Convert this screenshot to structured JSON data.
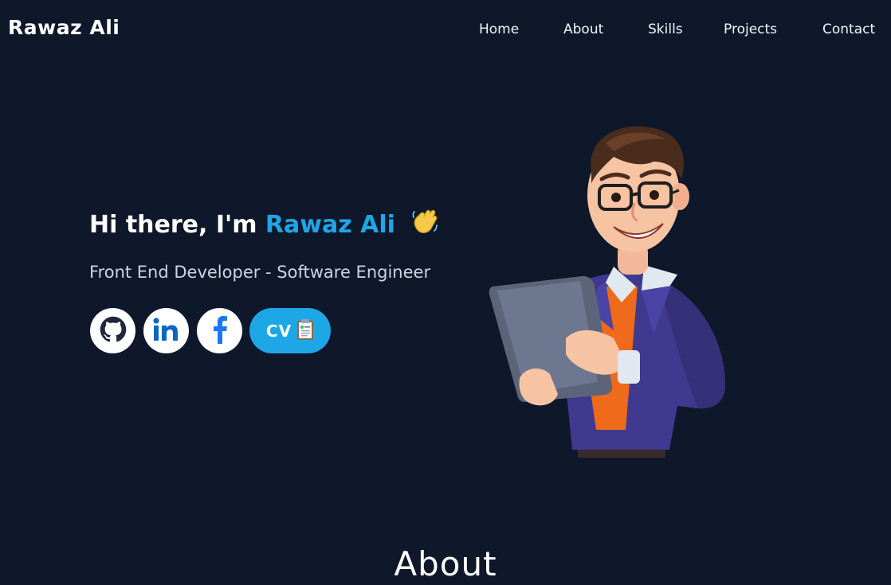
{
  "header": {
    "brand": "Rawaz Ali",
    "nav": [
      {
        "label": "Home"
      },
      {
        "label": "About"
      },
      {
        "label": "Skills"
      },
      {
        "label": "Projects"
      },
      {
        "label": "Contact"
      }
    ]
  },
  "hero": {
    "greeting": "Hi there, I'm",
    "name": "Rawaz Ali",
    "subtitle": "Front End Developer - Software Engineer",
    "socials": [
      {
        "icon": "github-icon"
      },
      {
        "icon": "linkedin-icon"
      },
      {
        "icon": "facebook-icon"
      }
    ],
    "cv_label": "CV",
    "accent_color": "#1ea7e6"
  },
  "about": {
    "heading": "About"
  },
  "colors": {
    "background": "#0f172a",
    "accent": "#1ea7e6"
  }
}
